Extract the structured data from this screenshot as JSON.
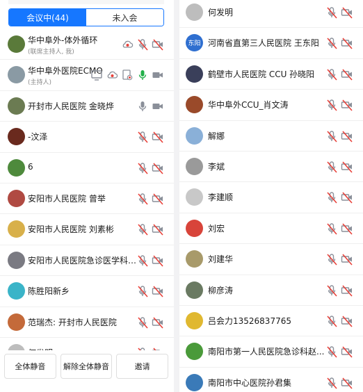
{
  "tabs": [
    {
      "label": "会议中(44)",
      "active": true
    },
    {
      "label": "未入会",
      "active": false
    }
  ],
  "left_participants": [
    {
      "name": "华中阜外-体外循环",
      "sub": "(联席主持人, 我)",
      "avatar_color": "#5a7a3a",
      "icons": [
        "cloud-record-icon",
        "mic-off-icon",
        "camera-off-icon"
      ]
    },
    {
      "name": "华中阜外医院ECMO",
      "sub": "(主持人)",
      "avatar_color": "#8a9aa4",
      "icons": [
        "screen-share-icon",
        "cloud-record-icon",
        "record-icon",
        "mic-on-icon",
        "camera-on-icon"
      ]
    },
    {
      "name": "开封市人民医院 金晓烨",
      "avatar_color": "#6b7b52",
      "icons": [
        "mic-on-icon",
        "camera-on-icon"
      ]
    },
    {
      "name": "-汶泽",
      "avatar_color": "#6a2a1e",
      "icons": [
        "mic-off-icon",
        "camera-off-icon"
      ]
    },
    {
      "name": "6",
      "avatar_color": "#4e8a3c",
      "icons": [
        "mic-off-icon",
        "camera-off-icon"
      ]
    },
    {
      "name": "安阳市人民医院  曾举",
      "avatar_color": "#b04a42",
      "icons": [
        "mic-off-icon",
        "camera-off-icon"
      ]
    },
    {
      "name": "安阳市人民医院 刘素彬",
      "avatar_color": "#d8b04a",
      "icons": [
        "mic-off-icon",
        "camera-off-icon"
      ]
    },
    {
      "name": "安阳市人民医院急诊医学科-李...",
      "avatar_color": "#7a7a82",
      "icons": [
        "mic-off-icon",
        "camera-off-icon"
      ]
    },
    {
      "name": "陈胜阳新乡",
      "avatar_color": "#3ab4c8",
      "icons": [
        "mic-off-icon",
        "camera-off-icon"
      ]
    },
    {
      "name": "范瑞杰:  开封市人民医院",
      "avatar_color": "#c46a3a",
      "icons": [
        "mic-off-icon",
        "camera-off-icon"
      ]
    },
    {
      "name": "何发明",
      "avatar_color": "#bdbdbd",
      "icons": [
        "mic-off-icon",
        "camera-off-icon"
      ]
    }
  ],
  "right_participants": [
    {
      "name": "何发明",
      "avatar_color": "#bdbdbd",
      "icons": [
        "mic-off-icon",
        "camera-off-icon"
      ]
    },
    {
      "name": "河南省直第三人民医院 王东阳",
      "avatar_color": "#2f6fd0",
      "avatar_text": "东阳",
      "icons": [
        "mic-off-icon",
        "camera-off-icon"
      ]
    },
    {
      "name": "鹤壁市人民医院 CCU 孙晓阳",
      "avatar_color": "#3a3f5a",
      "icons": [
        "mic-off-icon",
        "camera-off-icon"
      ]
    },
    {
      "name": "华中阜外CCU_肖文涛",
      "avatar_color": "#9a4a2a",
      "icons": [
        "mic-off-icon",
        "camera-off-icon"
      ]
    },
    {
      "name": "解娜",
      "avatar_color": "#8ab0d8",
      "icons": [
        "mic-off-icon",
        "camera-off-icon"
      ]
    },
    {
      "name": "李斌",
      "avatar_color": "#9a9a9a",
      "icons": [
        "mic-off-icon",
        "camera-off-icon"
      ]
    },
    {
      "name": "李建顺",
      "avatar_color": "#c8c8c8",
      "icons": [
        "mic-off-icon",
        "camera-off-icon"
      ]
    },
    {
      "name": "刘宏",
      "avatar_color": "#d8443a",
      "icons": [
        "mic-off-icon",
        "camera-off-icon"
      ]
    },
    {
      "name": "刘建华",
      "avatar_color": "#a89a6a",
      "icons": [
        "mic-off-icon",
        "camera-off-icon"
      ]
    },
    {
      "name": "柳彦涛",
      "avatar_color": "#6a7a62",
      "icons": [
        "mic-off-icon",
        "camera-off-icon"
      ]
    },
    {
      "name": "吕会力13526837765",
      "avatar_color": "#e0b830",
      "icons": [
        "mic-off-icon",
        "camera-off-icon"
      ]
    },
    {
      "name": "南阳市第一人民医院急诊科赵...",
      "avatar_color": "#4a9a3a",
      "icons": [
        "mic-off-icon",
        "camera-off-icon"
      ]
    },
    {
      "name": "南阳市中心医院孙君集",
      "avatar_color": "#3a7ab8",
      "icons": [
        "mic-off-icon",
        "camera-off-icon"
      ]
    }
  ],
  "bottom_buttons": [
    {
      "label": "全体静音",
      "name": "mute-all-button"
    },
    {
      "label": "解除全体静音",
      "name": "unmute-all-button"
    },
    {
      "label": "邀请",
      "name": "invite-button"
    }
  ],
  "colors": {
    "accent": "#1677ff",
    "muted_red": "#e8413a",
    "icon_gray": "#8a8f99",
    "icon_green": "#23b04a"
  }
}
